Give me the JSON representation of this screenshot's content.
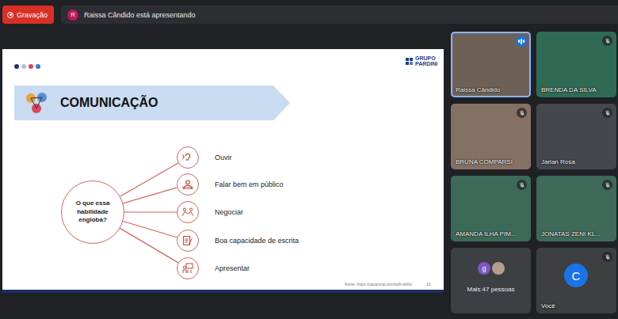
{
  "recording": {
    "label": "Gravação"
  },
  "presenter_bar": {
    "avatar": "R",
    "text": "Raissa Cândido está apresentando"
  },
  "slide": {
    "dots": [
      {
        "color": "#1f3370"
      },
      {
        "color": "#b8c0d8"
      },
      {
        "color": "#e0455c"
      },
      {
        "color": "#2f7fc1"
      }
    ],
    "logo": "GRUPO PARDINI",
    "title": "COMUNICAÇÃO",
    "hub": "O que essa habilidade engloba?",
    "items": [
      {
        "label": "Ouvir"
      },
      {
        "label": "Falar bem em público"
      },
      {
        "label": "Negociar"
      },
      {
        "label": "Boa capacidade de escrita"
      },
      {
        "label": "Apresentar"
      }
    ],
    "source": "Fonte: https://vacancra.com/soft-skills/",
    "page": "10"
  },
  "participants": [
    {
      "name": "Raissa Cândido",
      "muted": false,
      "speaking": true
    },
    {
      "name": "BRENDA DA SILVA",
      "muted": true,
      "speaking": false
    },
    {
      "name": "BRUNA COMPARSI",
      "muted": true,
      "speaking": false
    },
    {
      "name": "Jarlan Rosa",
      "muted": true,
      "speaking": false
    },
    {
      "name": "AMANDA ILHA PIM...",
      "muted": true,
      "speaking": false
    },
    {
      "name": "JONATAS ZENI KL...",
      "muted": true,
      "speaking": false
    }
  ],
  "others": {
    "avatar": "g",
    "label": "Mais 47 pessoas"
  },
  "self": {
    "avatar": "C",
    "label": "Você",
    "muted": true
  }
}
